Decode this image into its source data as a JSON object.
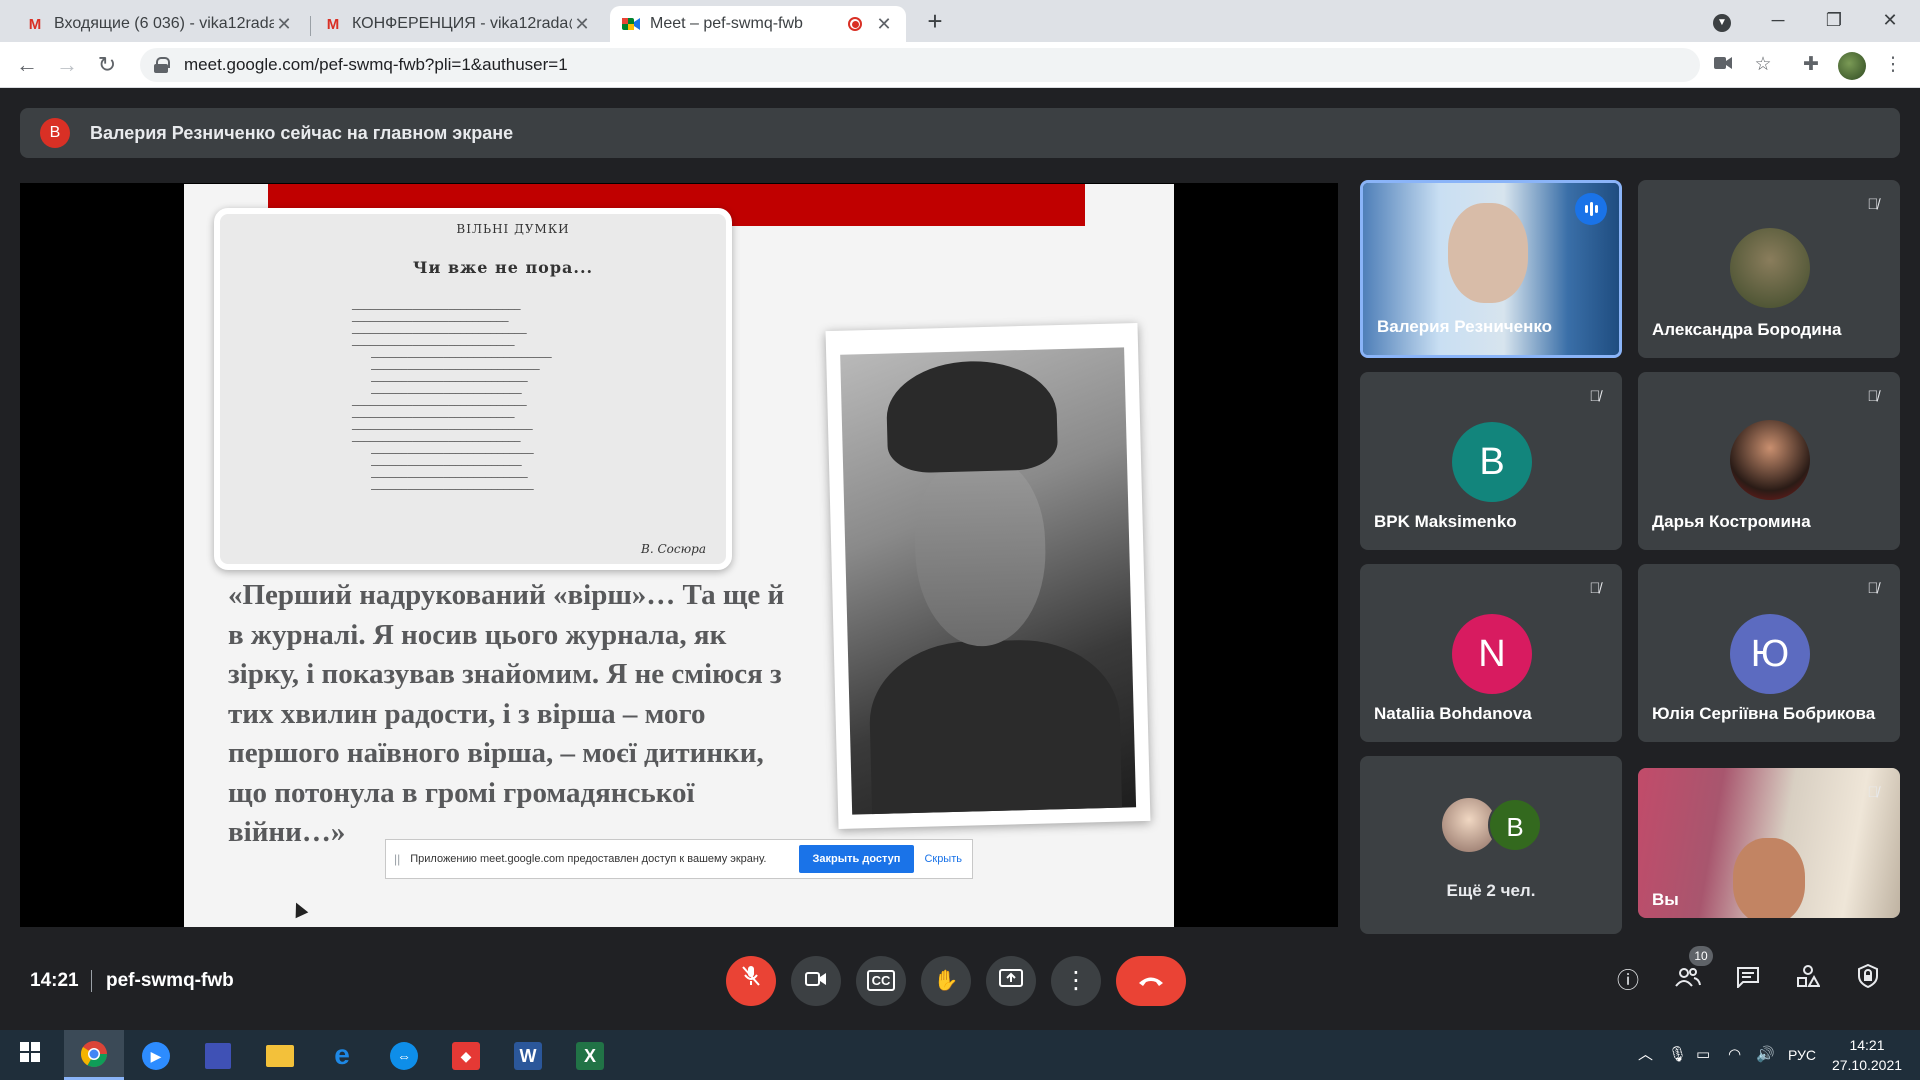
{
  "browser": {
    "tabs": [
      {
        "title": "Входящие (6 036) - vika12rada@",
        "icon": "gmail-icon",
        "close": "✕"
      },
      {
        "title": "КОНФЕРЕНЦИЯ - vika12rada@g",
        "icon": "gmail-icon",
        "close": "✕"
      },
      {
        "title": "Meet – pef-swmq-fwb",
        "icon": "meet-icon",
        "close": "✕",
        "active": true
      }
    ],
    "new_tab": "+",
    "url": "meet.google.com/pef-swmq-fwb?pli=1&authuser=1"
  },
  "meet": {
    "banner": {
      "avatar_letter": "В",
      "text": "Валерия Резниченко сейчас на главном экране"
    },
    "slide": {
      "clipping_heading": "ВІЛЬНІ ДУМКИ",
      "clipping_title": "Чи вже не пора...",
      "clipping_signature": "В. Сосюра",
      "quote": "«Перший надрукований «вірш»… Та ще й в журналі. Я носив цього журнала, як зірку, і показував знайомим. Я не сміюся з тих хвилин радости, і з вірша – мого першого наївного вірша, – моєї дитинки, що потонула в громі громадянської війни…»"
    },
    "share_bar": {
      "grip": "||",
      "message": "Приложению meet.google.com предоставлен доступ к вашему экрану.",
      "stop_label": "Закрыть доступ",
      "hide_label": "Скрыть"
    },
    "participants": [
      {
        "name": "Валерия Резниченко",
        "speaking": true
      },
      {
        "name": "Александра Бородина",
        "muted": true
      },
      {
        "name": "BPK Maksimenko",
        "letter": "B",
        "color": "#12857c",
        "muted": true
      },
      {
        "name": "Дарья Костромина",
        "muted": true
      },
      {
        "name": "Nataliia Bohdanova",
        "letter": "N",
        "color": "#d81b60",
        "muted": true
      },
      {
        "name": "Юлія Сергіївна Бобрикова",
        "letter": "Ю",
        "color": "#5c6bc0",
        "muted": true
      },
      {
        "more_label": "Ещё 2 чел.",
        "letter": "B",
        "color": "#33691e"
      },
      {
        "name": "Вы",
        "muted": true
      }
    ],
    "time": "14:21",
    "meeting_code": "pef-swmq-fwb",
    "people_count": "10"
  },
  "taskbar": {
    "language": "РУС",
    "time": "14:21",
    "date": "27.10.2021"
  }
}
